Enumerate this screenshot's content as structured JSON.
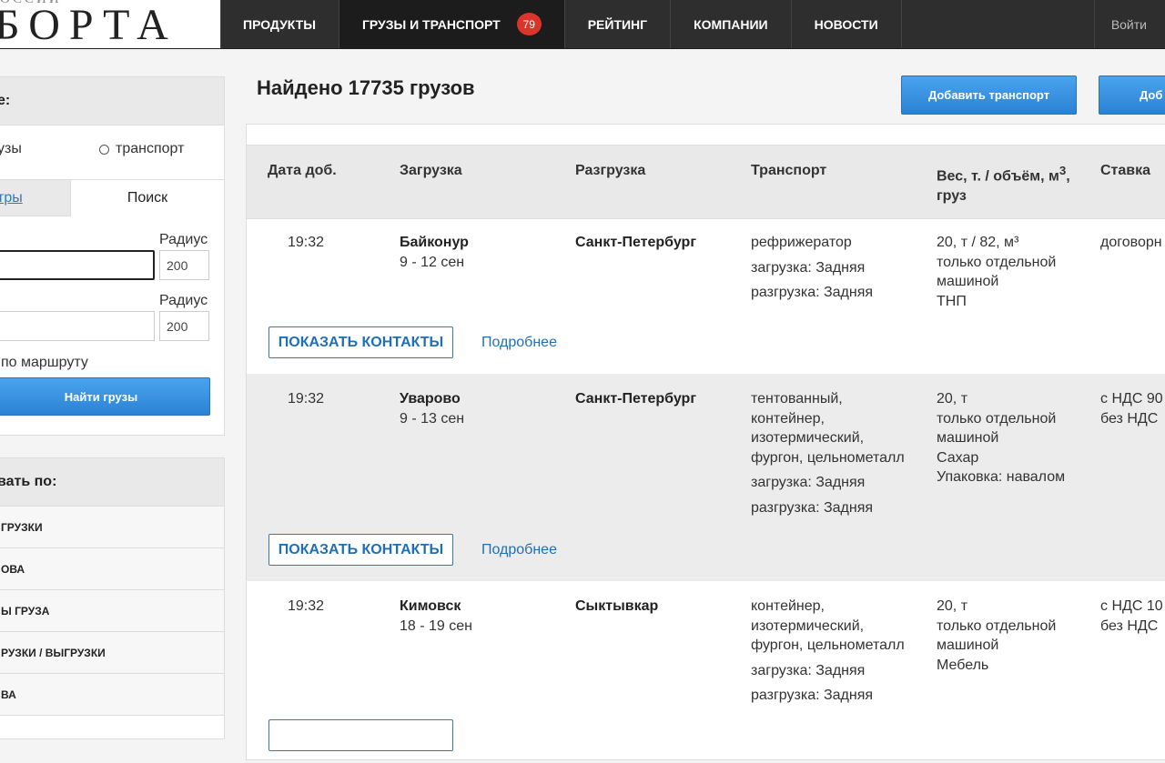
{
  "header": {
    "logo_top": "ОССИИ",
    "logo_main": "БОРТА",
    "nav": [
      {
        "label": "ПРОДУКТЫ"
      },
      {
        "label": "ГРУЗЫ И ТРАНСПОРТ",
        "badge": "79"
      },
      {
        "label": "РЕЙТИНГ"
      },
      {
        "label": "КОМПАНИИ"
      },
      {
        "label": "НОВОСТИ"
      }
    ],
    "login": "Войти"
  },
  "filter": {
    "title": "е:",
    "radio_cargo": "узы",
    "radio_transport": "транспорт",
    "tab_filters": "тры",
    "tab_search": "Поиск",
    "from_label": "",
    "to_label": ":",
    "radius_label": "Радиус",
    "radius_from": "200",
    "radius_to": "200",
    "route_label": "по маршруту",
    "find_button": "Найти грузы"
  },
  "sort": {
    "title": "вать по:",
    "items": [
      "ГРУЗКИ",
      "ОВА",
      "Ы ГРУЗА",
      "РУЗКИ / ВЫГРУЗКИ",
      "ВА",
      ""
    ]
  },
  "main": {
    "heading": "Найдено 17735 грузов",
    "add_transport": "Добавить транспорт",
    "add_cargo": "Доб",
    "columns": {
      "date": "Дата доб.",
      "load": "Загрузка",
      "unload": "Разгрузка",
      "transport": "Транспорт",
      "weight": "Вес, т. / объём, м",
      "weight_sup": "3",
      "weight_tail": ",",
      "weight_line2": "груз",
      "rate": "Ставка"
    },
    "show_contacts": "ПОКАЗАТЬ КОНТАКТЫ",
    "details": "Подробнее",
    "rows": [
      {
        "time": "19:32",
        "load_city": "Байконур",
        "load_dates": "9 - 12 сен",
        "unload_city": "Санкт-Петербург",
        "transport": "рефрижератор",
        "loading": "загрузка: Задняя",
        "unloading": "разгрузка: Задняя",
        "weight": "20, т / 82, м³",
        "weight_note1": "только отдельной",
        "weight_note2": "машиной",
        "cargo": "ТНП",
        "rate1": "договорн",
        "rate2": ""
      },
      {
        "time": "19:32",
        "load_city": "Уварово",
        "load_dates": "9 - 13 сен",
        "unload_city": "Санкт-Петербург",
        "transport_lines": [
          "тентованный,",
          "контейнер,",
          "изотермический,",
          "фургон, цельнометалл"
        ],
        "loading": "загрузка: Задняя",
        "unloading": "разгрузка: Задняя",
        "weight": "20, т",
        "weight_note1": "только отдельной",
        "weight_note2": "машиной",
        "cargo": "Сахар",
        "cargo2": "Упаковка: навалом",
        "rate1": "с НДС 90",
        "rate2": "без НДС"
      },
      {
        "time": "19:32",
        "load_city": "Кимовск",
        "load_dates": "18 - 19 сен",
        "unload_city": "Сыктывкар",
        "transport_lines": [
          "контейнер,",
          "изотермический,",
          "фургон, цельнометалл"
        ],
        "loading": "загрузка: Задняя",
        "unloading": "разгрузка: Задняя",
        "weight": "20, т",
        "weight_note1": "только отдельной",
        "weight_note2": "машиной",
        "cargo": "Мебель",
        "rate1": "с НДС 10",
        "rate2": "без НДС"
      }
    ]
  }
}
